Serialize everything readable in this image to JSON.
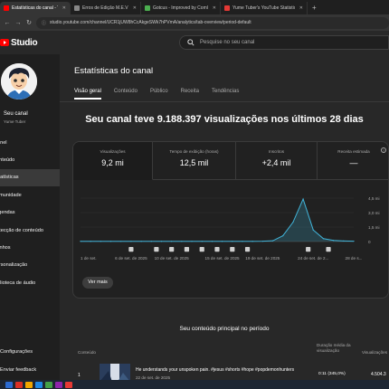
{
  "browser": {
    "tabs": [
      {
        "label": "Estatísticas do canal - YouTube",
        "active": true,
        "color": "#ff0000"
      },
      {
        "label": "Erros de Edição M.E.V",
        "active": false,
        "color": "#888888"
      },
      {
        "label": "Gotcus - Improved by Comlen",
        "active": false,
        "color": "#4caf50"
      },
      {
        "label": "Yume Tuber's YouTube Statistic",
        "active": false,
        "color": "#e53935"
      }
    ],
    "new_tab": "+",
    "url": "studio.youtube.com/channel/UCR1jUW8hCcAkgeSWk7hPVmA/analytics/tab-overview/period-default"
  },
  "header": {
    "logo_text": "Studio",
    "search_placeholder": "Pesquise no seu canal"
  },
  "sidebar": {
    "channel_title": "Seu canal",
    "channel_subtitle": "Yume Tuber",
    "items": [
      {
        "label": "Painel",
        "active": false
      },
      {
        "label": "Conteúdo",
        "active": false
      },
      {
        "label": "Estatísticas",
        "active": true
      },
      {
        "label": "Comunidade",
        "active": false
      },
      {
        "label": "Legendas",
        "active": false
      },
      {
        "label": "Detecção de conteúdo",
        "active": false
      },
      {
        "label": "Ganhos",
        "active": false
      },
      {
        "label": "Personalização",
        "active": false
      },
      {
        "label": "Biblioteca de áudio",
        "active": false
      }
    ],
    "settings": "Configurações",
    "feedback": "Enviar feedback"
  },
  "main": {
    "title": "Estatísticas do canal",
    "tabs": [
      {
        "label": "Visão geral",
        "active": true
      },
      {
        "label": "Conteúdo",
        "active": false
      },
      {
        "label": "Público",
        "active": false
      },
      {
        "label": "Receita",
        "active": false
      },
      {
        "label": "Tendências",
        "active": false
      }
    ],
    "headline": "Seu canal teve 9.188.397 visualizações nos últimos 28 dias",
    "metrics": [
      {
        "label": "Visualizações",
        "value": "9,2 mi",
        "selected": true
      },
      {
        "label": "Tempo de exibição (horas)",
        "value": "12,5 mil",
        "selected": false
      },
      {
        "label": "Inscritos",
        "value": "+2,4 mil",
        "selected": false
      },
      {
        "label": "Receita estimada",
        "value": "—",
        "selected": false
      }
    ],
    "see_more": "Ver mais",
    "top_content_title": "Seu conteúdo principal no período",
    "table_headers": {
      "content": "Conteúdo",
      "avg_duration": "Duração média da visualização",
      "views": "Visualizações"
    },
    "rows": [
      {
        "rank": "1",
        "title": "He understands your unspoken pain. #jesus #shorts #hope #popdemonhunters",
        "date": "22 de set. de 2025",
        "avg_duration": "0:11  (345,0%)",
        "views": "4.504.3"
      }
    ]
  },
  "chart_data": {
    "type": "line",
    "x": [
      "1 de set.",
      "2 de set.",
      "3 de set.",
      "4 de set.",
      "5 de set.",
      "6 de set.",
      "7 de set.",
      "8 de set.",
      "9 de set.",
      "10 de set.",
      "11 de set.",
      "12 de set.",
      "13 de set.",
      "14 de set.",
      "15 de set.",
      "16 de set.",
      "17 de set.",
      "18 de set.",
      "19 de set.",
      "20 de set.",
      "21 de set.",
      "22 de set.",
      "23 de set.",
      "24 de set.",
      "25 de set.",
      "26 de set.",
      "27 de set.",
      "28 de set."
    ],
    "series": [
      {
        "values": [
          20000,
          22000,
          20000,
          21000,
          19000,
          22000,
          21000,
          20000,
          22000,
          21000,
          20000,
          21000,
          22000,
          20000,
          21000,
          20000,
          22000,
          25000,
          30000,
          80000,
          600000,
          2000000,
          4400000,
          1200000,
          300000,
          120000,
          60000,
          40000
        ]
      }
    ],
    "xticks": [
      "1 de set.",
      "6 de set. de 2025",
      "10 de set. de 2025",
      "15 de set. de 2025",
      "19 de set. de 2025",
      "24 de set. de 2...",
      "28 de s..."
    ],
    "yticks": [
      "4,5 mi",
      "3,0 mi",
      "1,5 mi",
      "0"
    ],
    "ylim": [
      0,
      4500000
    ],
    "markers": [
      "1",
      "2",
      "3",
      "4",
      "5",
      "6",
      "7",
      "8",
      "9",
      "10"
    ],
    "color": "#41b4d9"
  }
}
